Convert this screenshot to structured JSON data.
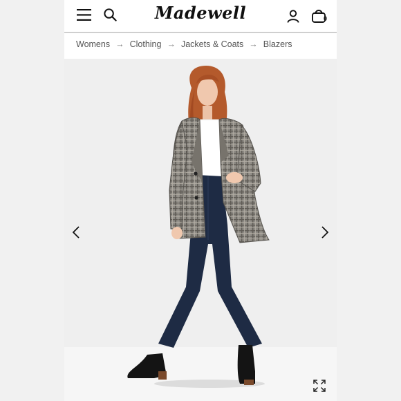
{
  "header": {
    "brand": "Madewell",
    "bag_count": "0",
    "icons": {
      "menu": "menu-icon",
      "search": "search-icon",
      "account": "account-icon",
      "bag": "shopping-bag-icon"
    }
  },
  "breadcrumb": {
    "items": [
      "Womens",
      "Clothing",
      "Jackets & Coats",
      "Blazers"
    ],
    "separator": "→"
  },
  "gallery": {
    "image_alt": "Model wearing a plaid double-breasted blazer, white tee, dark flare jeans and black ankle boots",
    "icons": {
      "prev": "chevron-left-icon",
      "next": "chevron-right-icon",
      "expand": "expand-icon"
    }
  },
  "colors": {
    "page_background": "#f1f1f1",
    "header_border": "#cfcfcf",
    "text": "#111111",
    "breadcrumb_text": "#555555"
  }
}
